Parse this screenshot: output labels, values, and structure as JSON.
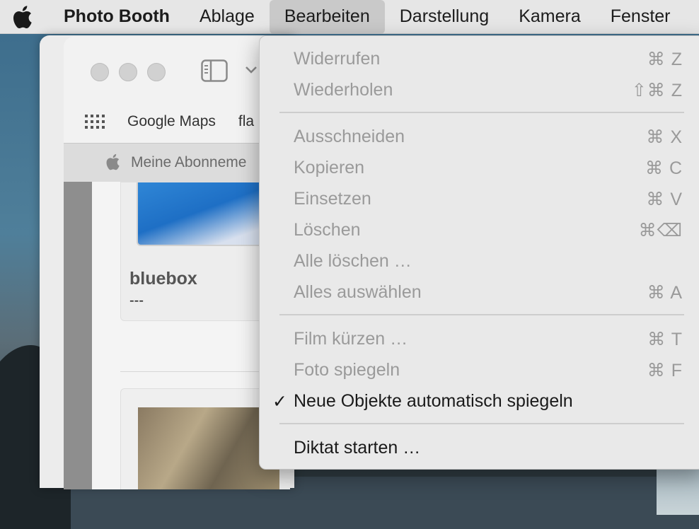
{
  "menubar": {
    "app_name": "Photo Booth",
    "items": [
      "Ablage",
      "Bearbeiten",
      "Darstellung",
      "Kamera",
      "Fenster"
    ]
  },
  "browser": {
    "bookmarks": [
      "Google Maps",
      "fla"
    ],
    "tab_label": "Meine Abonneme",
    "card_title": "bluebox",
    "card_subtitle": "---"
  },
  "edit_menu": {
    "items": [
      {
        "label": "Widerrufen",
        "shortcut": "⌘ Z",
        "enabled": false
      },
      {
        "label": "Wiederholen",
        "shortcut": "⇧⌘ Z",
        "enabled": false
      },
      {
        "label": "Ausschneiden",
        "shortcut": "⌘ X",
        "enabled": false
      },
      {
        "label": "Kopieren",
        "shortcut": "⌘ C",
        "enabled": false
      },
      {
        "label": "Einsetzen",
        "shortcut": "⌘ V",
        "enabled": false
      },
      {
        "label": "Löschen",
        "shortcut": "⌘⌫",
        "enabled": false
      },
      {
        "label": "Alle löschen …",
        "shortcut": "",
        "enabled": false
      },
      {
        "label": "Alles auswählen",
        "shortcut": "⌘ A",
        "enabled": false
      },
      {
        "label": "Film kürzen …",
        "shortcut": "⌘ T",
        "enabled": false
      },
      {
        "label": "Foto spiegeln",
        "shortcut": "⌘ F",
        "enabled": false
      },
      {
        "label": "Neue Objekte automatisch spiegeln",
        "shortcut": "",
        "enabled": true,
        "checked": true,
        "check_mark": "✓"
      },
      {
        "label": "Diktat starten …",
        "shortcut": "",
        "enabled": true
      }
    ]
  }
}
